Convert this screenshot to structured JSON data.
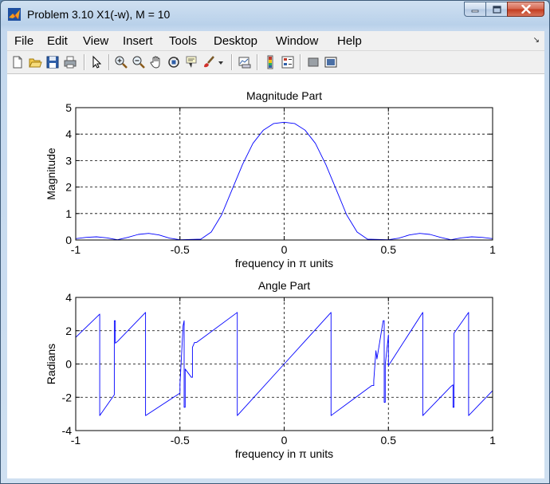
{
  "window": {
    "title": "Problem 3.10 X1(-w), M = 10",
    "controls": [
      "minimize",
      "maximize",
      "close"
    ]
  },
  "menu": {
    "items": [
      "File",
      "Edit",
      "View",
      "Insert",
      "Tools",
      "Desktop",
      "Window",
      "Help"
    ]
  },
  "toolbar": {
    "icons": [
      "new-figure-icon",
      "open-file-icon",
      "save-icon",
      "print-icon",
      "edit-plot-arrow-icon",
      "zoom-in-icon",
      "zoom-out-icon",
      "pan-hand-icon",
      "rotate-3d-icon",
      "data-cursor-icon",
      "brush-icon",
      "brush-dropdown-icon",
      "link-plot-icon",
      "insert-colorbar-icon",
      "insert-legend-icon",
      "hide-plot-tools-icon",
      "show-plot-tools-icon"
    ]
  },
  "chart_data": [
    {
      "type": "line",
      "title": "Magnitude Part",
      "xlabel": "frequency in π units",
      "ylabel": "Magnitude",
      "xlim": [
        -1,
        1
      ],
      "ylim": [
        0,
        5
      ],
      "xticks": [
        "-1",
        "-0.5",
        "0",
        "0.5",
        "1"
      ],
      "yticks": [
        "0",
        "1",
        "2",
        "3",
        "4",
        "5"
      ],
      "grid": "dashed",
      "series": [
        {
          "color": "#0000ff",
          "x": [
            -1,
            -0.95,
            -0.9,
            -0.85,
            -0.8,
            -0.75,
            -0.7,
            -0.65,
            -0.6,
            -0.55,
            -0.5,
            -0.45,
            -0.4,
            -0.35,
            -0.3,
            -0.25,
            -0.2,
            -0.15,
            -0.1,
            -0.05,
            0,
            0.05,
            0.1,
            0.15,
            0.2,
            0.25,
            0.3,
            0.35,
            0.4,
            0.45,
            0.5,
            0.55,
            0.6,
            0.65,
            0.7,
            0.75,
            0.8,
            0.85,
            0.9,
            0.95,
            1
          ],
          "y": [
            0.05,
            0.1,
            0.12,
            0.08,
            0.01,
            0.1,
            0.21,
            0.25,
            0.19,
            0.07,
            0.01,
            0.02,
            0.03,
            0.3,
            0.95,
            1.9,
            2.85,
            3.65,
            4.15,
            4.4,
            4.45,
            4.4,
            4.15,
            3.65,
            2.85,
            1.9,
            0.95,
            0.3,
            0.03,
            0.02,
            0.01,
            0.07,
            0.19,
            0.25,
            0.21,
            0.1,
            0.01,
            0.08,
            0.12,
            0.1,
            0.05
          ]
        }
      ]
    },
    {
      "type": "line",
      "title": "Angle Part",
      "xlabel": "frequency in π units",
      "ylabel": "Radians",
      "xlim": [
        -1,
        1
      ],
      "ylim": [
        -4,
        4
      ],
      "xticks": [
        "-1",
        "-0.5",
        "0",
        "0.5",
        "1"
      ],
      "yticks": [
        "-4",
        "-2",
        "0",
        "2",
        "4"
      ],
      "grid": "dashed",
      "series": [
        {
          "color": "#0000ff",
          "x": [
            -1,
            -0.885,
            -0.885,
            -0.815,
            -0.815,
            -0.81,
            -0.81,
            -0.8,
            -0.665,
            -0.665,
            -0.5,
            -0.5,
            -0.485,
            -0.485,
            -0.48,
            -0.48,
            -0.475,
            -0.475,
            -0.445,
            -0.44,
            -0.44,
            -0.43,
            -0.43,
            -0.42,
            -0.225,
            -0.225,
            0,
            0.225,
            0.225,
            0.42,
            0.43,
            0.43,
            0.44,
            0.44,
            0.445,
            0.475,
            0.475,
            0.48,
            0.48,
            0.485,
            0.485,
            0.5,
            0.5,
            0.665,
            0.665,
            0.8,
            0.81,
            0.81,
            0.815,
            0.815,
            0.885,
            0.885,
            1
          ],
          "y": [
            1.6,
            3.0,
            -3.1,
            -1.85,
            2.6,
            2.6,
            1.25,
            1.35,
            3.1,
            -3.1,
            -1.75,
            -1.2,
            2.3,
            2.3,
            2.6,
            -2.6,
            -2.6,
            -0.3,
            -0.8,
            -0.8,
            1.0,
            1.3,
            1.3,
            1.3,
            3.1,
            -3.1,
            0,
            3.1,
            -3.1,
            -1.3,
            -1.3,
            -1.0,
            0.8,
            0.8,
            0.3,
            2.6,
            2.6,
            2.6,
            -2.3,
            -2.3,
            -0.05,
            1.75,
            -0.1,
            3.1,
            -3.1,
            -1.35,
            -1.25,
            -2.6,
            -2.6,
            1.85,
            3.1,
            -3.1,
            -1.6
          ]
        }
      ]
    }
  ]
}
